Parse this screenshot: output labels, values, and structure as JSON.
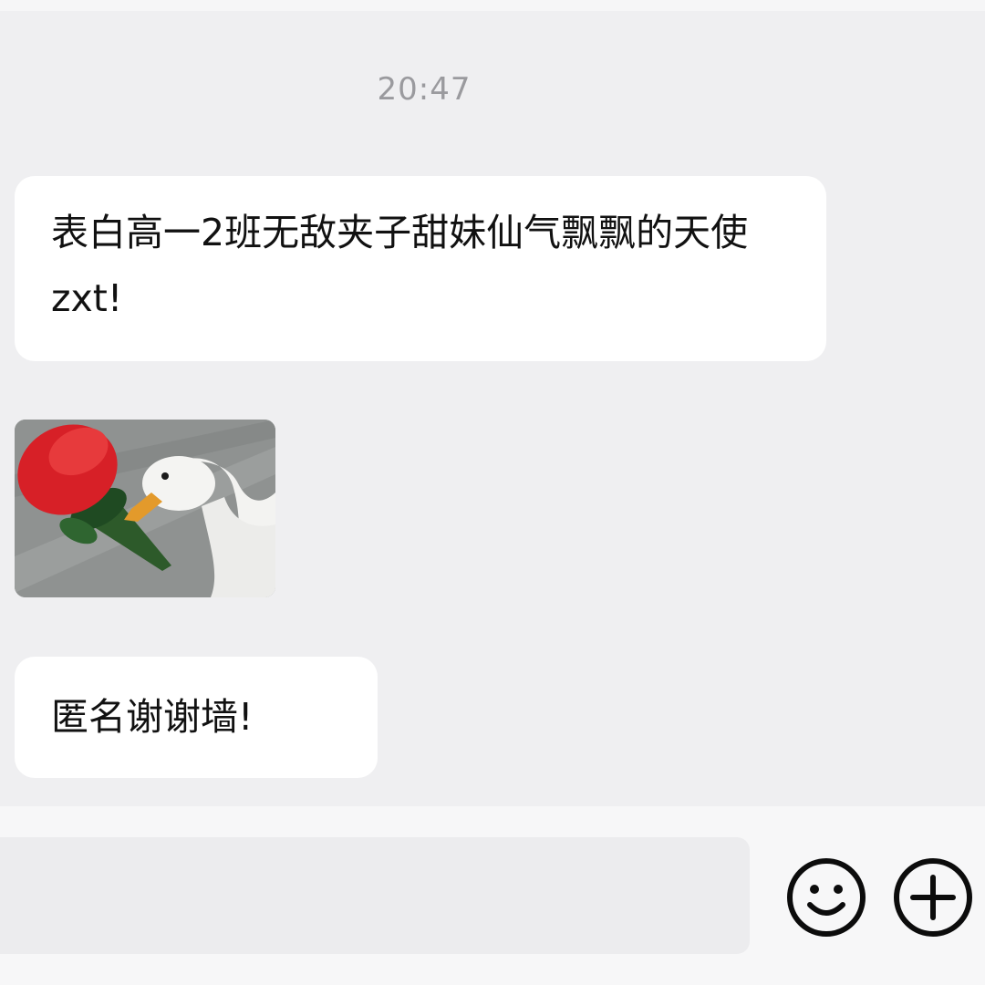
{
  "chat": {
    "timestamp": "20:47",
    "messages": [
      {
        "type": "text",
        "text": "表白高一2班无敌夹子甜妹仙气飘飘的天使zxt!"
      },
      {
        "type": "sticker",
        "description_icon": "goose-with-rose-sticker"
      },
      {
        "type": "text",
        "text": "匿名谢谢墙!"
      }
    ]
  },
  "input_bar": {
    "emoji_icon": "smiley-icon",
    "plus_icon": "plus-circle-icon"
  },
  "colors": {
    "background": "#efeff1",
    "bubble": "#ffffff",
    "timestamp": "#9a9a9e",
    "text": "#111111",
    "input_field": "#ececee"
  }
}
